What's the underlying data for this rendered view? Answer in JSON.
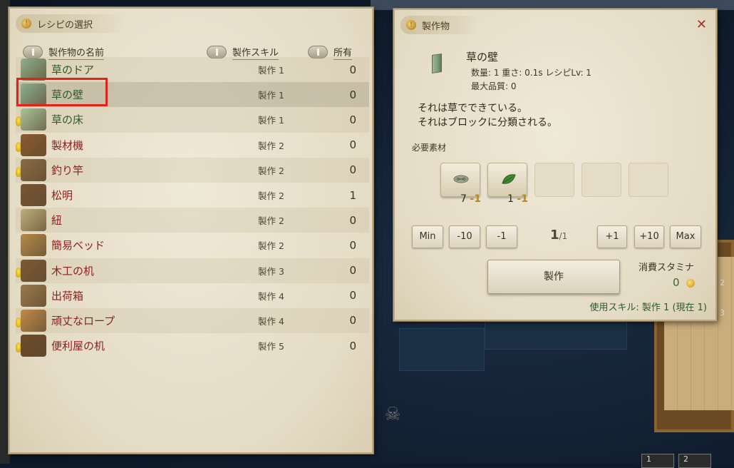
{
  "recipe_panel": {
    "title": "レシピの選択",
    "headers": {
      "name": "製作物の名前",
      "skill": "製作スキル",
      "owned": "所有"
    },
    "rows": [
      {
        "name": "草のドア",
        "skill": "製作 1",
        "owned": "0",
        "craftable": true,
        "hint": false,
        "icon": "grass-door-icon"
      },
      {
        "name": "草の壁",
        "skill": "製作 1",
        "owned": "0",
        "craftable": true,
        "hint": false,
        "icon": "grass-wall-icon"
      },
      {
        "name": "草の床",
        "skill": "製作 1",
        "owned": "0",
        "craftable": true,
        "hint": true,
        "icon": "grass-floor-icon"
      },
      {
        "name": "製材機",
        "skill": "製作 2",
        "owned": "0",
        "craftable": false,
        "hint": true,
        "icon": "sawmill-icon"
      },
      {
        "name": "釣り竿",
        "skill": "製作 2",
        "owned": "0",
        "craftable": false,
        "hint": true,
        "icon": "fishing-rod-icon"
      },
      {
        "name": "松明",
        "skill": "製作 2",
        "owned": "1",
        "craftable": false,
        "hint": false,
        "icon": "torch-icon"
      },
      {
        "name": "紐",
        "skill": "製作 2",
        "owned": "0",
        "craftable": false,
        "hint": false,
        "icon": "string-icon"
      },
      {
        "name": "簡易ベッド",
        "skill": "製作 2",
        "owned": "0",
        "craftable": false,
        "hint": false,
        "icon": "simple-bed-icon"
      },
      {
        "name": "木工の机",
        "skill": "製作 3",
        "owned": "0",
        "craftable": false,
        "hint": true,
        "icon": "woodwork-table-icon"
      },
      {
        "name": "出荷箱",
        "skill": "製作 4",
        "owned": "0",
        "craftable": false,
        "hint": false,
        "icon": "shipping-box-icon"
      },
      {
        "name": "頑丈なロープ",
        "skill": "製作 4",
        "owned": "0",
        "craftable": false,
        "hint": true,
        "icon": "sturdy-rope-icon"
      },
      {
        "name": "便利屋の机",
        "skill": "製作 5",
        "owned": "0",
        "craftable": false,
        "hint": true,
        "icon": "handyman-table-icon"
      }
    ]
  },
  "craft_panel": {
    "title": "製作物",
    "item_name": "草の壁",
    "stats_line1": "数量: 1  重さ: 0.1s  レシピLv: 1",
    "stats_line2": "最大品質: 0",
    "desc_line1": "それは草でできている。",
    "desc_line2": "それはブロックに分類される。",
    "materials_label": "必要素材",
    "materials": [
      {
        "have": "7",
        "need": "1",
        "icon": "grass-bundle-icon"
      },
      {
        "have": "1",
        "need": "1",
        "icon": "leaf-icon"
      }
    ],
    "qty_buttons": {
      "min": "Min",
      "minus10": "-10",
      "minus1": "-1",
      "plus1": "+1",
      "plus10": "+10",
      "max": "Max"
    },
    "quantity": "1",
    "quantity_max": "/1",
    "craft_button": "製作",
    "stamina_label": "消費スタミナ",
    "stamina_value": "0",
    "skill_used": "使用スキル: 製作 1 (現在 1)"
  },
  "hotbar": [
    "1",
    "2"
  ],
  "side_numbers": [
    "2",
    "3"
  ]
}
